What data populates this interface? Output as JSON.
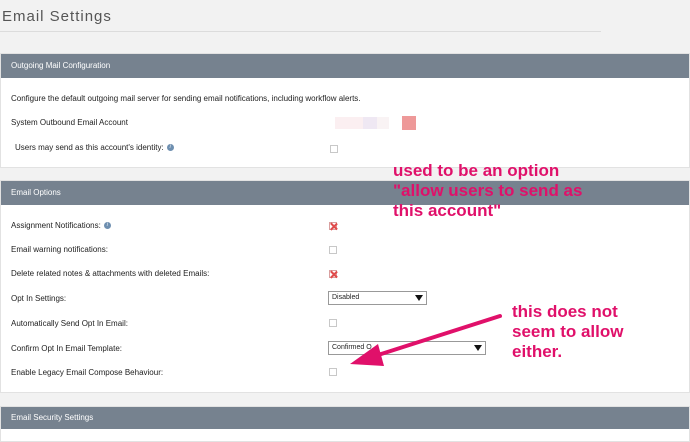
{
  "page": {
    "title": "Email Settings"
  },
  "outgoing": {
    "header": "Outgoing Mail Configuration",
    "description": "Configure the default outgoing mail server for sending email notifications, including workflow alerts.",
    "system_account_label": "System Outbound Email Account",
    "send_as_label": "Users may send as this account's identity:",
    "send_as_checked": false
  },
  "options": {
    "header": "Email Options",
    "assignment_label": "Assignment Notifications:",
    "assignment_checked": true,
    "warning_label": "Email warning notifications:",
    "warning_checked": false,
    "delete_label": "Delete related notes & attachments with deleted Emails:",
    "delete_checked": true,
    "optin_label": "Opt In Settings:",
    "optin_value": "Disabled",
    "auto_optin_label": "Automatically Send Opt In Email:",
    "auto_optin_checked": false,
    "confirm_template_label": "Confirm Opt In Email Template:",
    "confirm_template_value": "Confirmed O...",
    "legacy_label": "Enable Legacy Email Compose Behaviour:",
    "legacy_checked": false
  },
  "security": {
    "header": "Email Security Settings"
  },
  "annotations": {
    "note1_line1": "used to be an option",
    "note1_line2": "\"allow users to send as",
    "note1_line3": "this account\"",
    "note2_line1": "this does not",
    "note2_line2": "seem to allow",
    "note2_line3": "either."
  },
  "colors": {
    "header_bg": "#76828f",
    "annotation": "#e0106a",
    "check": "#e04b4b"
  }
}
